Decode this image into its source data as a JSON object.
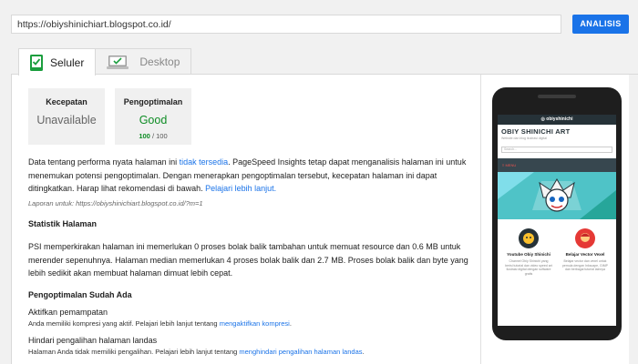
{
  "header": {
    "url_value": "https://obiyshinichiart.blogspot.co.id/",
    "analyze_label": "ANALISIS"
  },
  "tabs": [
    {
      "label": "Seluler",
      "active": true,
      "icon": "mobile-icon"
    },
    {
      "label": "Desktop",
      "active": false,
      "icon": "desktop-icon"
    }
  ],
  "scores": {
    "speed": {
      "title": "Kecepatan",
      "value": "Unavailable"
    },
    "optimization": {
      "title": "Pengoptimalan",
      "value": "Good",
      "score": "100",
      "max": "/ 100"
    }
  },
  "intro": {
    "text1": "Data tentang performa nyata halaman ini ",
    "link1": "tidak tersedia",
    "text2": ". PageSpeed Insights tetap dapat menganalisis halaman ini untuk menemukan potensi pengoptimalan. Dengan menerapkan pengoptimalan tersebut, kecepatan halaman ini dapat ditingkatkan. Harap lihat rekomendasi di bawah. ",
    "link2": "Pelajari lebih lanjut."
  },
  "report_line": "Laporan untuk: https://obiyshinichiart.blogspot.co.id/?m=1",
  "page_stats": {
    "heading": "Statistik Halaman",
    "text": "PSI memperkirakan halaman ini memerlukan 0 proses bolak balik tambahan untuk memuat resource dan 0.6 MB untuk merender sepenuhnya. Halaman median memerlukan 4 proses bolak balik dan 2.7 MB. Proses bolak balik dan byte yang lebih sedikit akan membuat halaman dimuat lebih cepat."
  },
  "optimizations": {
    "heading": "Pengoptimalan Sudah Ada",
    "items": [
      {
        "title": "Aktifkan pemampatan",
        "desc": "Anda memiliki kompresi yang aktif. Pelajari lebih lanjut tentang ",
        "link": "mengaktifkan kompresi",
        "end": "."
      },
      {
        "title": "Hindari pengalihan halaman landas",
        "desc": "Halaman Anda tidak memiliki pengalihan. Pelajari lebih lanjut tentang ",
        "link": "menghindari pengalihan halaman landas",
        "end": "."
      }
    ]
  },
  "preview": {
    "topnav": "obiyshinichi",
    "site_title": "OBIY SHINICHI ART",
    "site_subtitle": "Website dan blog ilustrasi digital",
    "search_placeholder": "Search...",
    "menu": "MENU",
    "cards": [
      {
        "title": "Youtube Obiy Shinichi",
        "text": "Channel Obiy Shinichi yang berisi tutorial dan video speed art ilustrasi digital dengan software gratis"
      },
      {
        "title": "Belajar Vector Vexel",
        "text": "Belajar vector dan vexel untuk pemula dengan Inkscape, GIMP dan berbagai tutorial lainnya"
      }
    ]
  },
  "colors": {
    "accent": "#1a73e8",
    "good": "#0d8c24",
    "mobile_green": "#1b9e3e",
    "banner": "#4fc3c7"
  }
}
